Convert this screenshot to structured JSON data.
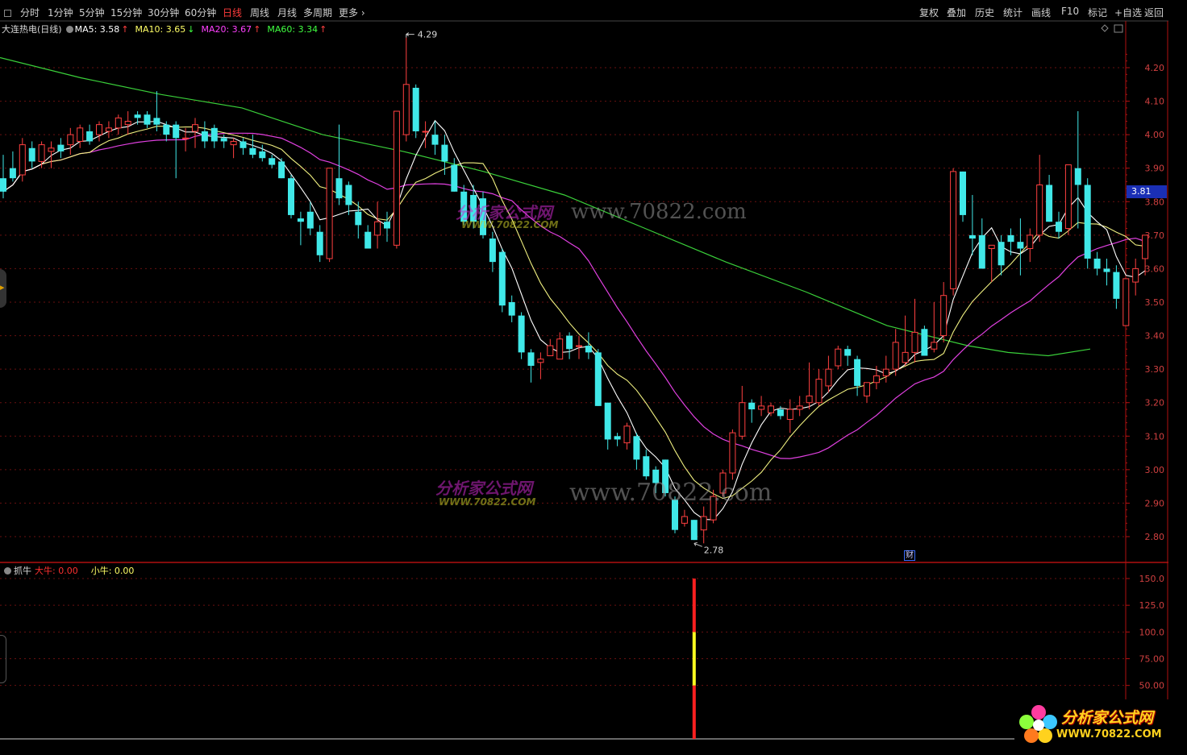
{
  "toolbar": {
    "periods": [
      "分时",
      "1分钟",
      "5分钟",
      "15分钟",
      "30分钟",
      "60分钟",
      "日线",
      "周线",
      "月线",
      "多周期",
      "更多"
    ],
    "active_period": "日线",
    "right_buttons": [
      "复权",
      "叠加",
      "历史",
      "统计",
      "画线",
      "F10",
      "标记",
      "+自选",
      "返回"
    ]
  },
  "main_chart": {
    "title": "大连热电(日线)",
    "ma": [
      {
        "label": "MA5: 3.58",
        "color": "#ffffff"
      },
      {
        "label": "MA10: 3.65",
        "color": "#ffff66"
      },
      {
        "label": "MA20: 3.67",
        "color": "#ff40ff"
      },
      {
        "label": "MA60: 3.34",
        "color": "#40ff40"
      }
    ],
    "high_label": "4.29",
    "low_label": "2.78",
    "current_price_tag": "3.81",
    "cai_badge": "财",
    "watermark_text": "www.70822.com",
    "watermark_cn": "分析家公式网",
    "watermark_url": "WWW.70822.COM"
  },
  "indicator": {
    "name": "抓牛",
    "big_label": "大牛: 0.00",
    "small_label": "小牛: 0.00",
    "y_ticks": [
      "150.0",
      "125.0",
      "100.0",
      "75.00",
      "50.00"
    ]
  },
  "logo": {
    "text": "分析家公式网",
    "url": "WWW.70822.COM"
  },
  "chart_data": {
    "type": "candlestick",
    "y_ticks": [
      "4.20",
      "4.10",
      "4.00",
      "3.90",
      "3.80",
      "3.70",
      "3.60",
      "3.50",
      "3.40",
      "3.30",
      "3.20",
      "3.10",
      "3.00",
      "2.90",
      "2.80"
    ],
    "ylim": [
      2.75,
      4.33
    ],
    "candles": [
      [
        3.87,
        3.94,
        3.81,
        3.83
      ],
      [
        3.9,
        3.95,
        3.86,
        3.87
      ],
      [
        3.88,
        3.99,
        3.86,
        3.97
      ],
      [
        3.96,
        3.98,
        3.9,
        3.92
      ],
      [
        3.92,
        3.98,
        3.9,
        3.97
      ],
      [
        3.95,
        3.98,
        3.9,
        3.96
      ],
      [
        3.97,
        3.99,
        3.93,
        3.95
      ],
      [
        3.97,
        4.02,
        3.94,
        4.0
      ],
      [
        3.98,
        4.03,
        3.96,
        4.02
      ],
      [
        4.01,
        4.03,
        3.97,
        3.98
      ],
      [
        4.0,
        4.04,
        3.98,
        4.03
      ],
      [
        4.01,
        4.04,
        3.99,
        4.02
      ],
      [
        4.02,
        4.06,
        4.0,
        4.05
      ],
      [
        4.03,
        4.07,
        4.0,
        4.04
      ],
      [
        4.06,
        4.07,
        4.03,
        4.05
      ],
      [
        4.06,
        4.07,
        4.02,
        4.03
      ],
      [
        4.05,
        4.13,
        4.01,
        4.03
      ],
      [
        4.03,
        4.04,
        3.98,
        4.0
      ],
      [
        4.03,
        4.04,
        3.87,
        3.99
      ],
      [
        3.99,
        4.02,
        3.95,
        3.99
      ],
      [
        4.01,
        4.05,
        3.96,
        4.03
      ],
      [
        4.01,
        4.04,
        3.96,
        3.98
      ],
      [
        4.02,
        4.03,
        3.96,
        3.98
      ],
      [
        3.99,
        4.0,
        3.96,
        3.98
      ],
      [
        3.97,
        3.99,
        3.93,
        3.98
      ],
      [
        3.98,
        3.99,
        3.94,
        3.96
      ],
      [
        3.96,
        4.0,
        3.93,
        3.94
      ],
      [
        3.95,
        3.97,
        3.92,
        3.93
      ],
      [
        3.93,
        3.94,
        3.9,
        3.91
      ],
      [
        3.92,
        3.93,
        3.87,
        3.87
      ],
      [
        3.87,
        3.88,
        3.75,
        3.76
      ],
      [
        3.75,
        3.77,
        3.67,
        3.74
      ],
      [
        3.77,
        3.8,
        3.7,
        3.72
      ],
      [
        3.71,
        3.73,
        3.62,
        3.64
      ],
      [
        3.63,
        3.9,
        3.62,
        3.9
      ],
      [
        3.87,
        4.03,
        3.79,
        3.81
      ],
      [
        3.85,
        3.86,
        3.76,
        3.79
      ],
      [
        3.77,
        3.8,
        3.69,
        3.73
      ],
      [
        3.71,
        3.73,
        3.67,
        3.66
      ],
      [
        3.7,
        3.8,
        3.66,
        3.74
      ],
      [
        3.74,
        3.77,
        3.68,
        3.72
      ],
      [
        3.67,
        4.07,
        3.66,
        4.07
      ],
      [
        4.0,
        4.29,
        3.98,
        4.15
      ],
      [
        4.14,
        4.15,
        3.99,
        4.01
      ],
      [
        4.01,
        4.04,
        3.96,
        4.01
      ],
      [
        4.0,
        4.04,
        3.94,
        3.97
      ],
      [
        3.97,
        4.0,
        3.88,
        3.92
      ],
      [
        3.91,
        3.93,
        3.83,
        3.83
      ],
      [
        3.83,
        3.85,
        3.73,
        3.74
      ],
      [
        3.82,
        3.85,
        3.72,
        3.74
      ],
      [
        3.81,
        3.83,
        3.69,
        3.7
      ],
      [
        3.69,
        3.71,
        3.59,
        3.62
      ],
      [
        3.65,
        3.66,
        3.47,
        3.49
      ],
      [
        3.5,
        3.52,
        3.44,
        3.46
      ],
      [
        3.46,
        3.47,
        3.33,
        3.35
      ],
      [
        3.35,
        3.36,
        3.26,
        3.31
      ],
      [
        3.32,
        3.35,
        3.27,
        3.33
      ],
      [
        3.34,
        3.39,
        3.34,
        3.37
      ],
      [
        3.33,
        3.41,
        3.33,
        3.39
      ],
      [
        3.4,
        3.41,
        3.33,
        3.36
      ],
      [
        3.37,
        3.4,
        3.33,
        3.37
      ],
      [
        3.37,
        3.41,
        3.33,
        3.35
      ],
      [
        3.35,
        3.36,
        3.19,
        3.19
      ],
      [
        3.2,
        3.2,
        3.06,
        3.09
      ],
      [
        3.1,
        3.11,
        3.07,
        3.09
      ],
      [
        3.08,
        3.14,
        3.06,
        3.13
      ],
      [
        3.1,
        3.11,
        3.0,
        3.03
      ],
      [
        3.04,
        3.06,
        2.97,
        2.98
      ],
      [
        3.0,
        3.01,
        2.93,
        2.96
      ],
      [
        3.03,
        3.03,
        2.92,
        2.93
      ],
      [
        2.91,
        2.92,
        2.81,
        2.82
      ],
      [
        2.84,
        2.88,
        2.83,
        2.86
      ],
      [
        2.85,
        2.85,
        2.79,
        2.79
      ],
      [
        2.82,
        2.89,
        2.78,
        2.86
      ],
      [
        2.85,
        2.94,
        2.84,
        2.92
      ],
      [
        2.93,
        3.0,
        2.92,
        2.99
      ],
      [
        2.99,
        3.12,
        2.97,
        3.11
      ],
      [
        3.1,
        3.25,
        3.09,
        3.2
      ],
      [
        3.2,
        3.21,
        3.14,
        3.18
      ],
      [
        3.18,
        3.22,
        3.16,
        3.19
      ],
      [
        3.17,
        3.2,
        3.16,
        3.19
      ],
      [
        3.18,
        3.19,
        3.15,
        3.16
      ],
      [
        3.15,
        3.21,
        3.11,
        3.18
      ],
      [
        3.18,
        3.22,
        3.16,
        3.19
      ],
      [
        3.2,
        3.32,
        3.18,
        3.22
      ],
      [
        3.2,
        3.3,
        3.19,
        3.27
      ],
      [
        3.25,
        3.34,
        3.23,
        3.3
      ],
      [
        3.31,
        3.37,
        3.3,
        3.36
      ],
      [
        3.36,
        3.37,
        3.31,
        3.34
      ],
      [
        3.33,
        3.34,
        3.22,
        3.25
      ],
      [
        3.22,
        3.26,
        3.2,
        3.26
      ],
      [
        3.26,
        3.31,
        3.24,
        3.28
      ],
      [
        3.28,
        3.34,
        3.26,
        3.3
      ],
      [
        3.3,
        3.42,
        3.28,
        3.38
      ],
      [
        3.32,
        3.46,
        3.31,
        3.35
      ],
      [
        3.35,
        3.51,
        3.32,
        3.41
      ],
      [
        3.42,
        3.43,
        3.35,
        3.34
      ],
      [
        3.36,
        3.5,
        3.35,
        3.38
      ],
      [
        3.4,
        3.56,
        3.38,
        3.52
      ],
      [
        3.54,
        3.9,
        3.52,
        3.89
      ],
      [
        3.89,
        3.89,
        3.74,
        3.76
      ],
      [
        3.7,
        3.82,
        3.64,
        3.69
      ],
      [
        3.7,
        3.75,
        3.6,
        3.6
      ],
      [
        3.66,
        3.67,
        3.56,
        3.67
      ],
      [
        3.68,
        3.7,
        3.58,
        3.61
      ],
      [
        3.7,
        3.72,
        3.64,
        3.68
      ],
      [
        3.68,
        3.75,
        3.58,
        3.66
      ],
      [
        3.66,
        3.72,
        3.62,
        3.7
      ],
      [
        3.7,
        3.94,
        3.68,
        3.85
      ],
      [
        3.85,
        3.88,
        3.74,
        3.74
      ],
      [
        3.74,
        3.77,
        3.69,
        3.71
      ],
      [
        3.72,
        3.9,
        3.7,
        3.91
      ],
      [
        3.9,
        4.07,
        3.72,
        3.85
      ],
      [
        3.85,
        3.87,
        3.6,
        3.63
      ],
      [
        3.63,
        3.65,
        3.58,
        3.6
      ],
      [
        3.6,
        3.63,
        3.55,
        3.59
      ],
      [
        3.59,
        3.61,
        3.48,
        3.51
      ],
      [
        3.43,
        3.57,
        3.43,
        3.57
      ],
      [
        3.56,
        3.63,
        3.52,
        3.6
      ],
      [
        3.63,
        3.7,
        3.58,
        3.7
      ]
    ],
    "indicator_bar": {
      "index": 72,
      "segments": [
        {
          "from": 0,
          "to": 50,
          "color": "#ff2020"
        },
        {
          "from": 50,
          "to": 100,
          "color": "#ffff20"
        },
        {
          "from": 100,
          "to": 150,
          "color": "#ff2020"
        }
      ]
    },
    "indicator_ylim": [
      0,
      160
    ]
  }
}
